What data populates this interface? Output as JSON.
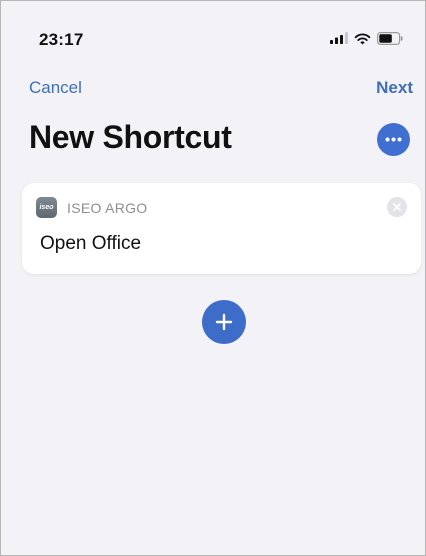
{
  "status_bar": {
    "time": "23:17"
  },
  "nav": {
    "cancel_label": "Cancel",
    "next_label": "Next"
  },
  "header": {
    "title": "New Shortcut"
  },
  "action_card": {
    "app_icon_text": "iseo",
    "app_name": "ISEO ARGO",
    "action_label": "Open Office"
  },
  "icons": {
    "more": "ellipsis-icon",
    "remove": "close-icon",
    "add": "plus-icon"
  },
  "colors": {
    "accent": "#3f6fb5",
    "button_fill": "#3d6cc9",
    "background": "#f2f2f7",
    "card": "#ffffff",
    "secondary_text": "#8e8e93"
  }
}
